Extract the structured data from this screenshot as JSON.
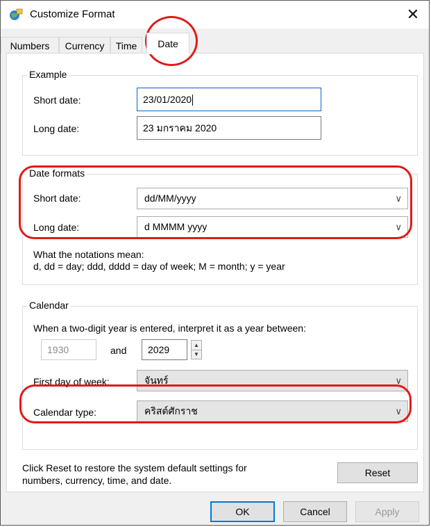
{
  "window": {
    "title": "Customize Format",
    "close_glyph": "✕",
    "app_icon": "regional-settings-icon"
  },
  "tabs": [
    {
      "label": "Numbers"
    },
    {
      "label": "Currency"
    },
    {
      "label": "Time"
    },
    {
      "label": "Date",
      "selected": true
    }
  ],
  "example": {
    "title": "Example",
    "short_label": "Short date:",
    "short_value": "23/01/2020",
    "long_label": "Long date:",
    "long_value": "23 มกราคม 2020"
  },
  "formats": {
    "title": "Date formats",
    "short_label": "Short date:",
    "short_value": "dd/MM/yyyy",
    "long_label": "Long date:",
    "long_value": "d MMMM yyyy",
    "notation_title": "What the notations mean:",
    "notation_text": "d, dd = day;  ddd, dddd = day of week;  M = month;  y = year"
  },
  "calendar": {
    "title": "Calendar",
    "two_digit_text": "When a two-digit year is entered, interpret it as a year between:",
    "year_from": "1930",
    "and_label": "and",
    "year_to": "2029",
    "first_day_label": "First day of week:",
    "first_day_value": "จันทร์",
    "type_label": "Calendar type:",
    "type_value": "คริสต์ศักราช"
  },
  "footer": {
    "reset_text_line1": "Click Reset to restore the system default settings for",
    "reset_text_line2": "numbers, currency, time, and date.",
    "reset_label": "Reset",
    "ok_label": "OK",
    "cancel_label": "Cancel",
    "apply_label": "Apply"
  },
  "colors": {
    "annotation": "#e01a1a",
    "focus_border": "#0a62c9",
    "default_button_border": "#0078d7"
  }
}
